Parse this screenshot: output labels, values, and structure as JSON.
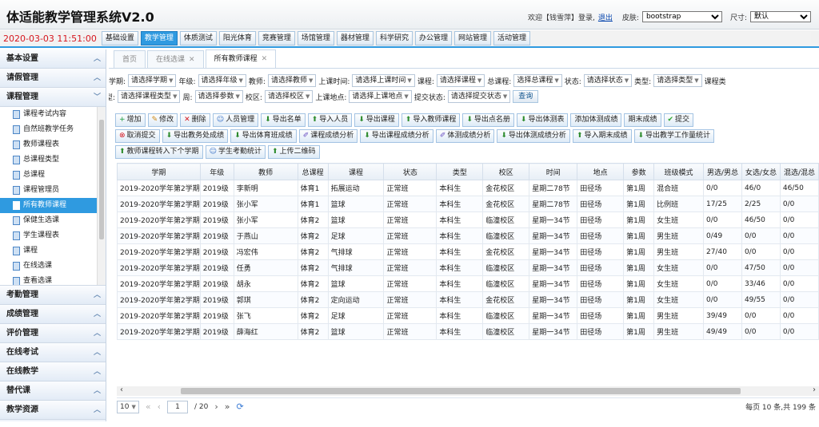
{
  "app": {
    "title": "体适能教学管理系统V2.0",
    "welcome": "欢迎【钱雪萍】登录,",
    "logout": "退出",
    "skin_label": "皮肤:",
    "skin_value": "bootstrap",
    "size_label": "尺寸:",
    "size_value": "默认"
  },
  "topnav": {
    "clock": "2020-03-03 11:51:00",
    "items": [
      "基础设置",
      "教学管理",
      "体质测试",
      "阳光体育",
      "竞赛管理",
      "场馆管理",
      "器材管理",
      "科学研究",
      "办公管理",
      "网站管理",
      "活动管理"
    ],
    "active_index": 1
  },
  "sidebar": {
    "sections_top": [
      "基本设置",
      "请假管理",
      "课程管理"
    ],
    "course_items": [
      "课程考试内容",
      "自然班教学任务",
      "教师课程表",
      "总课程类型",
      "总课程",
      "课程管理员",
      "所有教师课程",
      "保健生选课",
      "学生课程表",
      "课程",
      "在线选课",
      "查看选课"
    ],
    "active_item": 6,
    "sections_bottom": [
      "考勤管理",
      "成绩管理",
      "评价管理",
      "在线考试",
      "在线教学",
      "替代课",
      "教学资源"
    ]
  },
  "tabs": [
    {
      "label": "首页"
    },
    {
      "label": "在线选课",
      "closable": true
    },
    {
      "label": "所有教师课程",
      "closable": true,
      "active": true
    }
  ],
  "filters": {
    "row1": [
      {
        "label": "学期:",
        "value": "请选择学期"
      },
      {
        "label": "年级:",
        "value": "请选择年级"
      },
      {
        "label": "教师:",
        "value": "请选择教师"
      },
      {
        "label": "上课时间:",
        "value": "请选择上课时间"
      },
      {
        "label": "课程:",
        "value": "请选择课程"
      },
      {
        "label": "总课程:",
        "value": "选择总课程"
      },
      {
        "label": "状态:",
        "value": "请选择状态"
      },
      {
        "label": "类型:",
        "value": "请选择类型"
      },
      {
        "label": "课程类",
        "value": ""
      }
    ],
    "row2": [
      {
        "label": "型:",
        "value": "请选择课程类型"
      },
      {
        "label": "周:",
        "value": "请选择参数"
      },
      {
        "label": "校区:",
        "value": "请选择校区"
      },
      {
        "label": "上课地点:",
        "value": "请选择上课地点"
      },
      {
        "label": "提交状态:",
        "value": "请选择提交状态"
      }
    ],
    "query": "查询"
  },
  "toolbar": {
    "row1": [
      {
        "icon": "plus-icon",
        "label": "增加"
      },
      {
        "icon": "edit-icon",
        "label": "修改"
      },
      {
        "icon": "delete-icon",
        "label": "删除"
      },
      {
        "icon": "user-icon",
        "label": "人员管理"
      },
      {
        "icon": "download-icon",
        "label": "导出名单"
      },
      {
        "icon": "upload-icon",
        "label": "导入人员"
      },
      {
        "icon": "download-icon",
        "label": "导出课程"
      },
      {
        "icon": "upload-icon",
        "label": "导入教师课程"
      },
      {
        "icon": "download-icon",
        "label": "导出点名册"
      },
      {
        "icon": "download-icon",
        "label": "导出体测表"
      },
      {
        "icon": "",
        "label": "添加体测成绩"
      },
      {
        "icon": "",
        "label": "期末成绩"
      },
      {
        "icon": "check-icon",
        "label": "提交"
      }
    ],
    "row2": [
      {
        "icon": "cancel-icon",
        "label": "取消提交"
      },
      {
        "icon": "download-icon",
        "label": "导出教务处成绩"
      },
      {
        "icon": "download-icon",
        "label": "导出体育班成绩"
      },
      {
        "icon": "brush-icon",
        "label": "课程成绩分析"
      },
      {
        "icon": "download-icon",
        "label": "导出课程成绩分析"
      },
      {
        "icon": "brush-icon",
        "label": "体测成绩分析"
      },
      {
        "icon": "download-icon",
        "label": "导出体测成绩分析"
      },
      {
        "icon": "upload-icon",
        "label": "导入期末成绩"
      },
      {
        "icon": "download-icon",
        "label": "导出教学工作量统计"
      }
    ],
    "row3": [
      {
        "icon": "upload-icon",
        "label": "教师课程转入下个学期"
      },
      {
        "icon": "user-icon",
        "label": "学生考勤统计"
      },
      {
        "icon": "upload-icon",
        "label": "上传二维码"
      }
    ]
  },
  "table": {
    "headers": [
      "学期",
      "年级",
      "教师",
      "总课程",
      "课程",
      "状态",
      "类型",
      "校区",
      "时间",
      "地点",
      "参数",
      "班级模式",
      "男选/男总",
      "女选/女总",
      "混选/混总"
    ],
    "rows": [
      [
        "2019-2020学年第2学期",
        "2019级",
        "李新明",
        "体育1",
        "拓展运动",
        "正常班",
        "本科生",
        "金花校区",
        "星期二78节",
        "田径场",
        "第1周",
        "混合班",
        "0/0",
        "46/0",
        "46/50"
      ],
      [
        "2019-2020学年第2学期",
        "2019级",
        "张小军",
        "体育1",
        "篮球",
        "正常班",
        "本科生",
        "金花校区",
        "星期二78节",
        "田径场",
        "第1周",
        "比例班",
        "17/25",
        "2/25",
        "0/0"
      ],
      [
        "2019-2020学年第2学期",
        "2019级",
        "张小军",
        "体育2",
        "篮球",
        "正常班",
        "本科生",
        "临潼校区",
        "星期一34节",
        "田径场",
        "第1周",
        "女生班",
        "0/0",
        "46/50",
        "0/0"
      ],
      [
        "2019-2020学年第2学期",
        "2019级",
        "于燕山",
        "体育2",
        "足球",
        "正常班",
        "本科生",
        "临潼校区",
        "星期一34节",
        "田径场",
        "第1周",
        "男生班",
        "0/49",
        "0/0",
        "0/0"
      ],
      [
        "2019-2020学年第2学期",
        "2019级",
        "冯宏伟",
        "体育2",
        "气排球",
        "正常班",
        "本科生",
        "金花校区",
        "星期一34节",
        "田径场",
        "第1周",
        "男生班",
        "27/40",
        "0/0",
        "0/0"
      ],
      [
        "2019-2020学年第2学期",
        "2019级",
        "任勇",
        "体育2",
        "气排球",
        "正常班",
        "本科生",
        "临潼校区",
        "星期一34节",
        "田径场",
        "第1周",
        "女生班",
        "0/0",
        "47/50",
        "0/0"
      ],
      [
        "2019-2020学年第2学期",
        "2019级",
        "胡永",
        "体育2",
        "篮球",
        "正常班",
        "本科生",
        "临潼校区",
        "星期一34节",
        "田径场",
        "第1周",
        "女生班",
        "0/0",
        "33/46",
        "0/0"
      ],
      [
        "2019-2020学年第2学期",
        "2019级",
        "郭琪",
        "体育2",
        "定向运动",
        "正常班",
        "本科生",
        "金花校区",
        "星期一34节",
        "田径场",
        "第1周",
        "女生班",
        "0/0",
        "49/55",
        "0/0"
      ],
      [
        "2019-2020学年第2学期",
        "2019级",
        "张飞",
        "体育2",
        "足球",
        "正常班",
        "本科生",
        "临潼校区",
        "星期一34节",
        "田径场",
        "第1周",
        "男生班",
        "39/49",
        "0/0",
        "0/0"
      ],
      [
        "2019-2020学年第2学期",
        "2019级",
        "薛海红",
        "体育2",
        "篮球",
        "正常班",
        "本科生",
        "临潼校区",
        "星期一34节",
        "田径场",
        "第1周",
        "男生班",
        "49/49",
        "0/0",
        "0/0"
      ]
    ]
  },
  "pager": {
    "page_size": "10",
    "current_page": "1",
    "total_pages": "/ 20",
    "summary": "每页 10 条,共 199 条"
  }
}
